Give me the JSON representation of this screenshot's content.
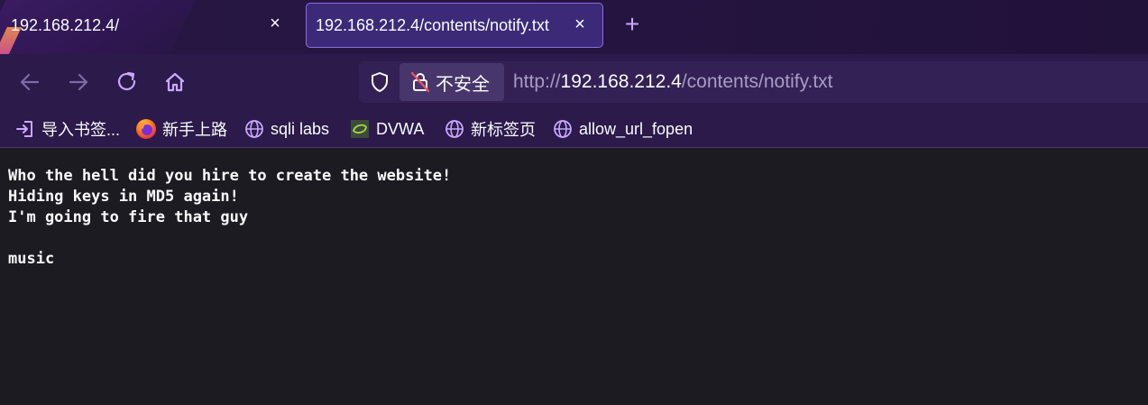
{
  "tabs": [
    {
      "title": "192.168.212.4/",
      "close": "×",
      "active": false
    },
    {
      "title": "192.168.212.4/contents/notify.txt",
      "close": "×",
      "active": true
    }
  ],
  "new_tab_label": "+",
  "nav": {
    "back_icon": "arrow-left-icon",
    "forward_icon": "arrow-right-icon",
    "reload_icon": "reload-icon",
    "home_icon": "home-icon"
  },
  "urlbar": {
    "insecure_label": "不安全",
    "url_scheme": "http://",
    "url_host": "192.168.212.4",
    "url_path": "/contents/notify.txt"
  },
  "bookmarks": [
    {
      "label": "导入书签...",
      "icon": "import-icon"
    },
    {
      "label": "新手上路",
      "icon": "firefox-icon"
    },
    {
      "label": "sqli labs",
      "icon": "globe-icon"
    },
    {
      "label": "DVWA",
      "icon": "dvwa-icon"
    },
    {
      "label": "新标签页",
      "icon": "globe-icon"
    },
    {
      "label": "allow_url_fopen",
      "icon": "globe-icon"
    }
  ],
  "content": {
    "lines": [
      "Who the hell did you hire to create the website!",
      "Hiding keys in MD5 again!",
      "I'm going to fire that guy",
      "",
      "music"
    ]
  },
  "colors": {
    "tabstrip_bg": "#251541",
    "toolbar_bg": "#2b1a4a",
    "active_tab_bg": "#3c2a78",
    "accent": "#c8a8ff",
    "page_bg": "#1c1b22",
    "text": "#fbfbfe"
  }
}
